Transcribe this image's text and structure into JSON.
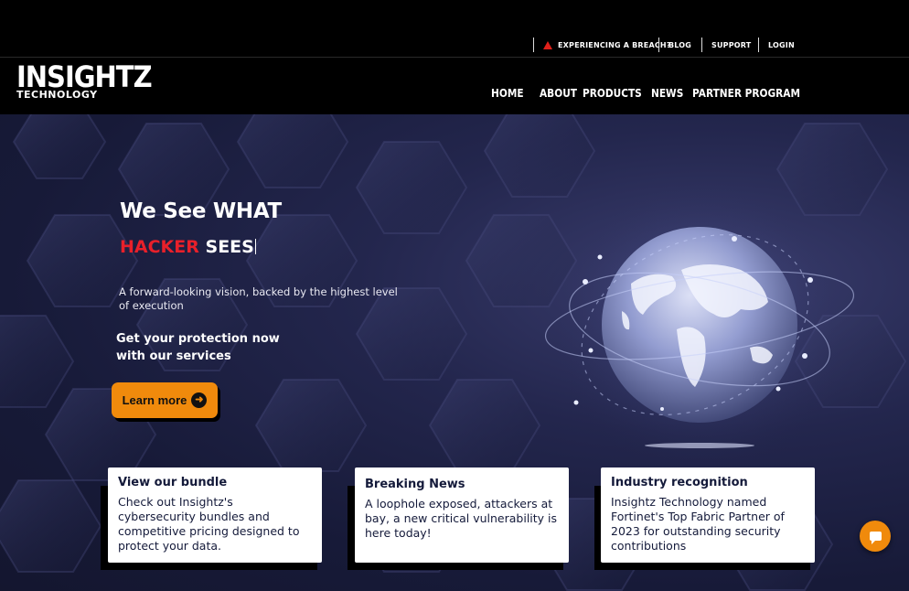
{
  "utility": {
    "breach": "EXPERIENCING A BREACH?",
    "blog": "BLOG",
    "support": "SUPPORT",
    "login": "LOGIN"
  },
  "logo": {
    "line1": "INSIGHTZ",
    "line2": "TECHNOLOGY"
  },
  "nav": {
    "home": "HOME",
    "about": "ABOUT",
    "products": "PRODUCTS",
    "news": "NEWS",
    "partner": "PARTNER PROGRAM"
  },
  "hero": {
    "title_line1": "We See WHAT",
    "title_red": "HACKER",
    "title_white": " SEES",
    "subtitle": "A forward-looking vision, backed by the highest level of execution",
    "cta_text": "Get your protection now with our services",
    "button": "Learn more",
    "button_icon": "arrow-right-circle-icon"
  },
  "cards": [
    {
      "title": "View our bundle",
      "body": "Check out Insightz's cybersecurity bundles and competitive pricing designed to protect your data."
    },
    {
      "title": "Breaking News",
      "body": "A loophole exposed, attackers at bay, a new critical vulnerability is here today!"
    },
    {
      "title": "Industry recognition",
      "body": "Insightz Technology named Fortinet's Top Fabric Partner of 2023 for outstanding security contributions"
    }
  ],
  "colors": {
    "accent": "#f08a0c",
    "alert": "#e8202a",
    "hero_bg": "#1c1f42"
  },
  "chat_icon": "chat-bubble-icon"
}
